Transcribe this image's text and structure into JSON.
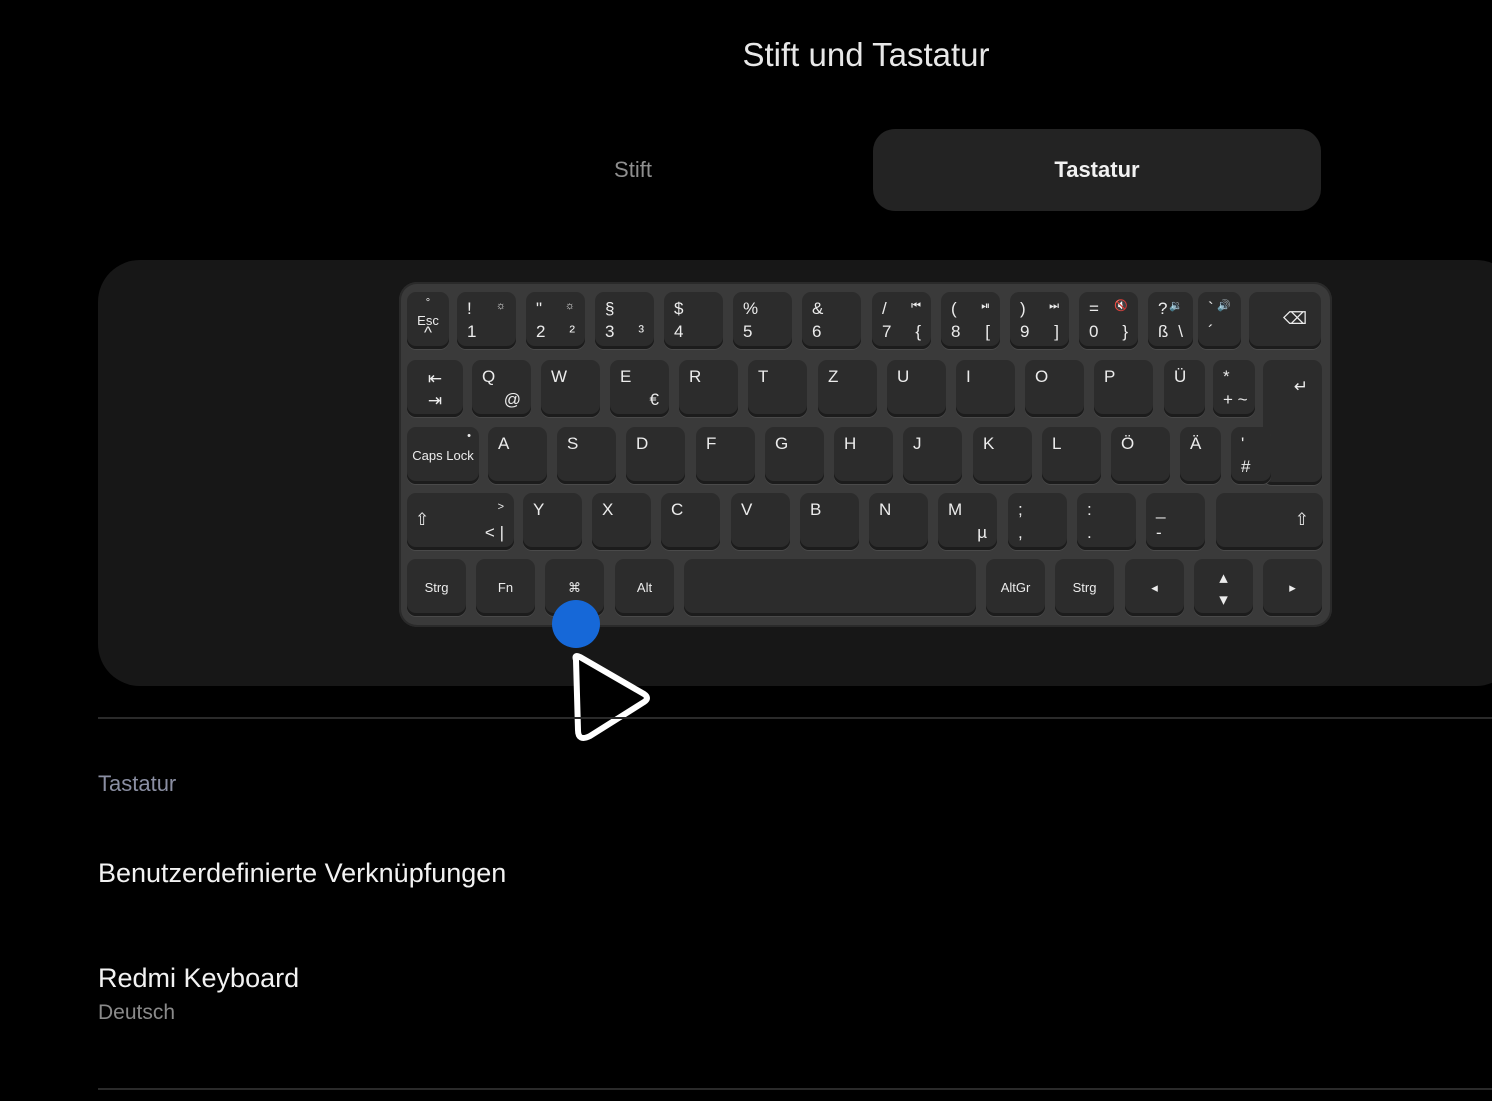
{
  "header": {
    "title": "Stift und Tastatur"
  },
  "tabs": [
    {
      "label": "Stift",
      "selected": false
    },
    {
      "label": "Tastatur",
      "selected": true
    }
  ],
  "colors": {
    "background": "#000000",
    "selected_tab": "#232323",
    "touch_indicator": "#1668d8",
    "section_label": "#8a8ea2"
  },
  "keyboard": {
    "row1": [
      {
        "top": "°",
        "mid": "Esc",
        "bot": "^"
      },
      {
        "tl": "!",
        "tr": "☼",
        "bl": "1"
      },
      {
        "tl": "\"",
        "tr": "☼",
        "bl": "2",
        "br": "²"
      },
      {
        "tl": "§",
        "bl": "3",
        "br": "³"
      },
      {
        "tl": "$",
        "bl": "4"
      },
      {
        "tl": "%",
        "bl": "5"
      },
      {
        "tl": "&",
        "bl": "6"
      },
      {
        "tl": "/",
        "tr": "⏮",
        "bl": "7",
        "br": "{"
      },
      {
        "tl": "(",
        "tr": "⏯",
        "bl": "8",
        "br": "["
      },
      {
        "tl": ")",
        "tr": "⏭",
        "bl": "9",
        "br": "]"
      },
      {
        "tl": "=",
        "tr": "🔇",
        "bl": "0",
        "br": "}"
      },
      {
        "tl": "?",
        "tr": "🔉",
        "bl": "ß",
        "br": "\\"
      },
      {
        "tl": "`",
        "tr": "🔊",
        "bl": "´"
      },
      {
        "icon": "⌫"
      }
    ],
    "row2": [
      {
        "top": "⇤",
        "bot": "⇥"
      },
      {
        "tl": "Q",
        "br": "@"
      },
      {
        "tl": "W"
      },
      {
        "tl": "E",
        "br": "€"
      },
      {
        "tl": "R"
      },
      {
        "tl": "T"
      },
      {
        "tl": "Z"
      },
      {
        "tl": "U"
      },
      {
        "tl": "I"
      },
      {
        "tl": "O"
      },
      {
        "tl": "P"
      },
      {
        "tl": "Ü"
      },
      {
        "tl": "*",
        "bl": "+ ~"
      },
      {
        "icon": "↵"
      }
    ],
    "row3": [
      {
        "mid": "Caps Lock",
        "dot": "•"
      },
      {
        "tl": "A"
      },
      {
        "tl": "S"
      },
      {
        "tl": "D"
      },
      {
        "tl": "F"
      },
      {
        "tl": "G"
      },
      {
        "tl": "H"
      },
      {
        "tl": "J"
      },
      {
        "tl": "K"
      },
      {
        "tl": "L"
      },
      {
        "tl": "Ö"
      },
      {
        "tl": "Ä"
      },
      {
        "tl": "'",
        "bl": "#"
      }
    ],
    "row4": [
      {
        "icon": "⇧",
        "tr": ">",
        "br": "< |"
      },
      {
        "tl": "Y"
      },
      {
        "tl": "X"
      },
      {
        "tl": "C"
      },
      {
        "tl": "V"
      },
      {
        "tl": "B"
      },
      {
        "tl": "N"
      },
      {
        "tl": "M",
        "br": "µ"
      },
      {
        "tl": ";",
        "bl": ","
      },
      {
        "tl": ":",
        "bl": "."
      },
      {
        "tl": "_",
        "bl": "-"
      },
      {
        "icon": "⇧"
      }
    ],
    "row5": [
      {
        "mid": "Strg"
      },
      {
        "mid": "Fn"
      },
      {
        "mid": "⌘"
      },
      {
        "mid": "Alt"
      },
      {
        "mid": ""
      },
      {
        "mid": "AltGr"
      },
      {
        "mid": "Strg"
      },
      {
        "mid": "◂"
      },
      {
        "top": "▴",
        "bot": "▾"
      },
      {
        "mid": "▸"
      }
    ]
  },
  "section": {
    "label": "Tastatur"
  },
  "items": [
    {
      "title": "Benutzerdefinierte Verknüpfungen"
    },
    {
      "title": "Redmi Keyboard",
      "subtitle": "Deutsch"
    }
  ]
}
